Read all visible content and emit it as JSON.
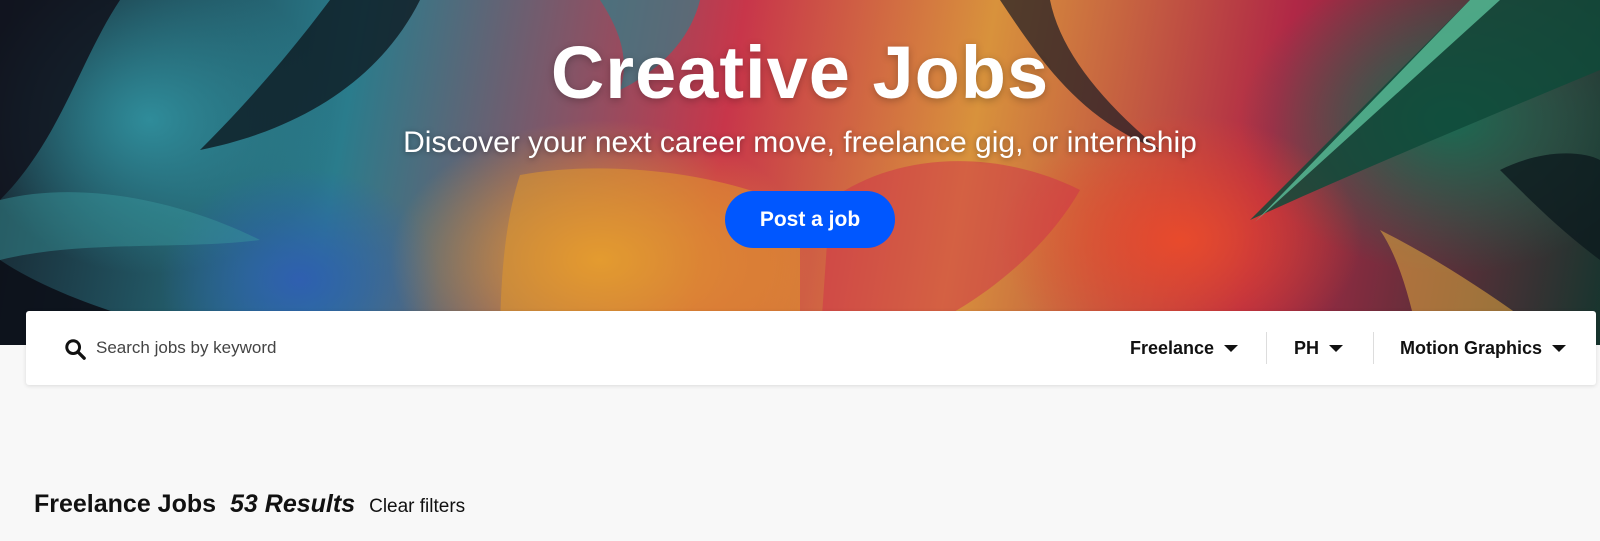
{
  "hero": {
    "title": "Creative Jobs",
    "subtitle": "Discover your next career move, freelance gig, or internship",
    "post_button_label": "Post a job",
    "button_color": "#0057ff"
  },
  "search": {
    "placeholder": "Search jobs by keyword",
    "value": "",
    "icon": "search-icon"
  },
  "filters": [
    {
      "label": "Freelance",
      "icon": "caret-down-icon"
    },
    {
      "label": "PH",
      "icon": "caret-down-icon"
    },
    {
      "label": "Motion Graphics",
      "icon": "caret-down-icon"
    }
  ],
  "results": {
    "title": "Freelance Jobs",
    "count": "53 Results",
    "clear_label": "Clear filters"
  }
}
